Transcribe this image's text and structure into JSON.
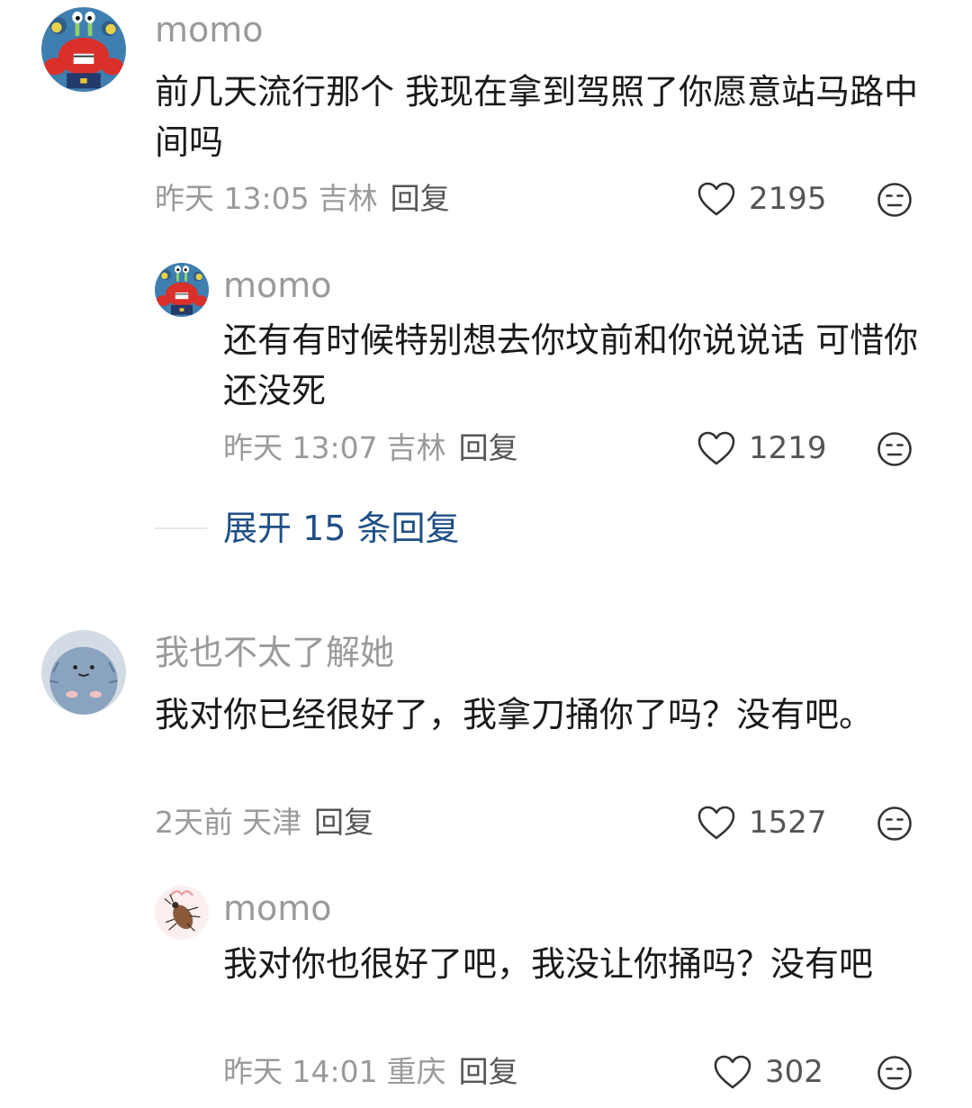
{
  "comments": [
    {
      "author": "momo",
      "text": "前几天流行那个 我现在拿到驾照了你愿意站马路中间吗",
      "time": "昨天 13:05",
      "location": "吉林",
      "reply_label": "回复",
      "likes": "2195",
      "avatar": "crab-avatar"
    },
    {
      "author": "momo",
      "text": "还有有时候特别想去你坟前和你说说话 可惜你还没死",
      "time": "昨天 13:07",
      "location": "吉林",
      "reply_label": "回复",
      "likes": "1219",
      "avatar": "crab-avatar"
    },
    {
      "author": "我也不太了解她",
      "text": "我对你已经很好了，我拿刀捅你了吗？没有吧。",
      "time": "2天前",
      "location": "天津",
      "reply_label": "回复",
      "likes": "1527",
      "avatar": "hedgehog-avatar"
    },
    {
      "author": "momo",
      "text": "我对你也很好了吧，我没让你捅吗？没有吧",
      "time": "昨天 14:01",
      "location": "重庆",
      "reply_label": "回复",
      "likes": "302",
      "avatar": "bug-avatar"
    }
  ],
  "expand_replies": "展开 15 条回复",
  "colors": {
    "author": "#9a9a9a",
    "body": "#1a1a1a",
    "link": "#1f4f86",
    "meta": "#9a9a9a"
  }
}
